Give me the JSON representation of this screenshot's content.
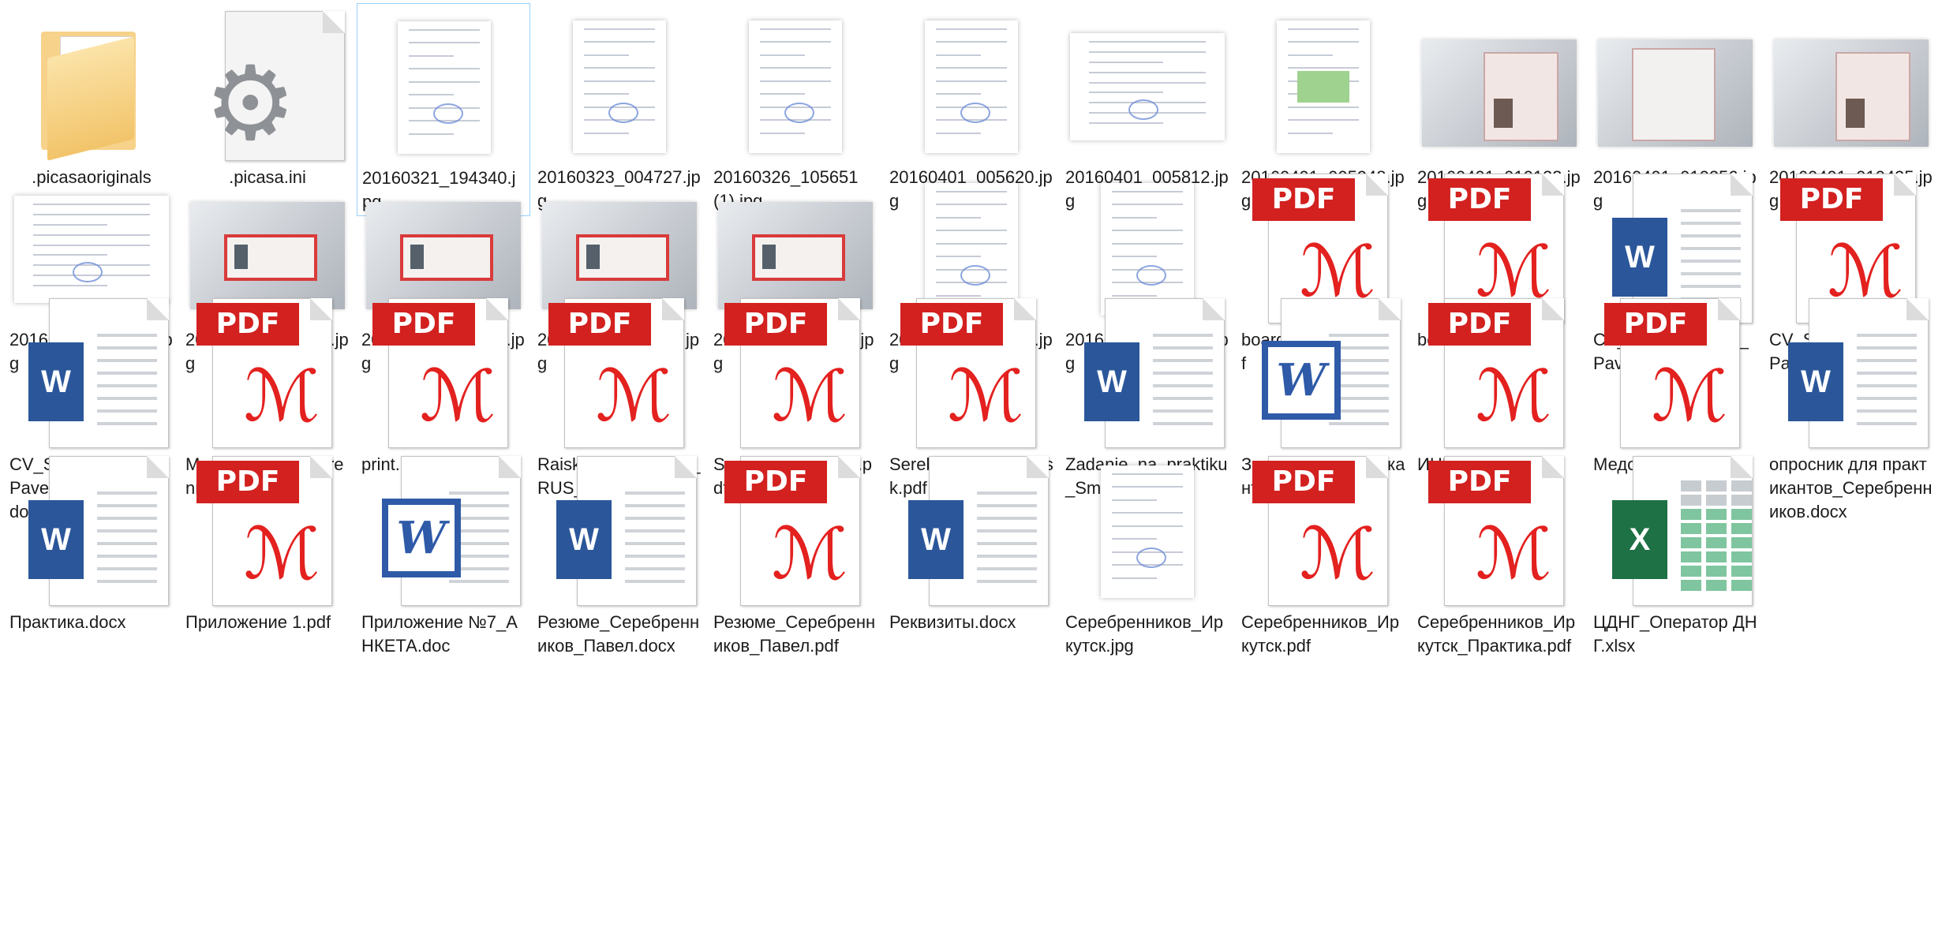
{
  "files": [
    {
      "name": ".picasaoriginals",
      "type": "folder"
    },
    {
      "name": ".picasa.ini",
      "type": "settings"
    },
    {
      "name": "20160321_194340.jpg",
      "type": "jpg-doc",
      "selected": true
    },
    {
      "name": "20160323_004727.jpg",
      "type": "jpg-doc"
    },
    {
      "name": "20160326_105651 (1).jpg",
      "type": "jpg-doc"
    },
    {
      "name": "20160401_005620.jpg",
      "type": "jpg-doc"
    },
    {
      "name": "20160401_005812.jpg",
      "type": "jpg-landscape-doc"
    },
    {
      "name": "20160401_005948.jpg",
      "type": "jpg-doc-green"
    },
    {
      "name": "20160401_010123.jpg",
      "type": "jpg-passport"
    },
    {
      "name": "20160401_010256.jpg",
      "type": "jpg-passport-page"
    },
    {
      "name": "20160401_010425.jpg",
      "type": "jpg-passport"
    },
    {
      "name": "20160401_010612.jpg",
      "type": "jpg-landscape-doc"
    },
    {
      "name": "20160401_010737.jpg",
      "type": "jpg-redbook"
    },
    {
      "name": "20160401_010853.jpg",
      "type": "jpg-redbook"
    },
    {
      "name": "20160401_011014.jpg",
      "type": "jpg-redbook"
    },
    {
      "name": "20160401_011139.jpg",
      "type": "jpg-redbook"
    },
    {
      "name": "20160401_210205.jpg",
      "type": "jpg-doc"
    },
    {
      "name": "20160401_210323.jpg",
      "type": "jpg-doc"
    },
    {
      "name": "boarding-pass (1).pdf",
      "type": "pdf"
    },
    {
      "name": "boarding-pass.pdf",
      "type": "pdf"
    },
    {
      "name": "CV_Serebrennikov_Pavel.docx",
      "type": "docx"
    },
    {
      "name": "CV_Serebrennikov_Pavel.pdf",
      "type": "pdf"
    },
    {
      "name": "CV_Serebrennikov_Pavel_COMMENTS.docx",
      "type": "docx"
    },
    {
      "name": "Medosmotr_Serebrennikov.pdf",
      "type": "pdf"
    },
    {
      "name": "print.pdf",
      "type": "pdf"
    },
    {
      "name": "Raiskiy_Yuriy_-_CV_RUS_2016.pdf",
      "type": "pdf"
    },
    {
      "name": "Serebrennikov_CV.pdf",
      "type": "pdf"
    },
    {
      "name": "Serebrennikov_Irkutsk.pdf",
      "type": "pdf"
    },
    {
      "name": "Zadanie_na_praktiku_Smirkina.docx",
      "type": "docx"
    },
    {
      "name": "Заявление практиканта.doc",
      "type": "doc"
    },
    {
      "name": "ИНН.pdf",
      "type": "pdf"
    },
    {
      "name": "Медосмотр.pdf",
      "type": "pdf"
    },
    {
      "name": "опросник для практикантов_Серебренников.docx",
      "type": "docx"
    },
    {
      "name": "Практика.docx",
      "type": "docx"
    },
    {
      "name": "Приложение 1.pdf",
      "type": "pdf"
    },
    {
      "name": "Приложение №7_АНКЕТА.doc",
      "type": "doc"
    },
    {
      "name": "Резюме_Серебренников_Павел.docx",
      "type": "docx"
    },
    {
      "name": "Резюме_Серебренников_Павел.pdf",
      "type": "pdf"
    },
    {
      "name": "Реквизиты.docx",
      "type": "docx"
    },
    {
      "name": "Серебренников_Иркутск.jpg",
      "type": "jpg-doc"
    },
    {
      "name": "Серебренников_Иркутск.pdf",
      "type": "pdf"
    },
    {
      "name": "Серебренников_Иркутск_Практика.pdf",
      "type": "pdf"
    },
    {
      "name": "ЦДНГ_Оператор ДНГ.xlsx",
      "type": "xlsx"
    }
  ],
  "icons": {
    "pdf_badge": "PDF",
    "word_letter": "W",
    "excel_letter": "X",
    "acrobat_glyph": "ℳ"
  },
  "colors": {
    "pdf_red": "#d2211f",
    "word_blue": "#2b579a",
    "excel_green": "#1e7145",
    "selection_border": "#99d1ff",
    "folder_yellow": "#f2c46a"
  }
}
